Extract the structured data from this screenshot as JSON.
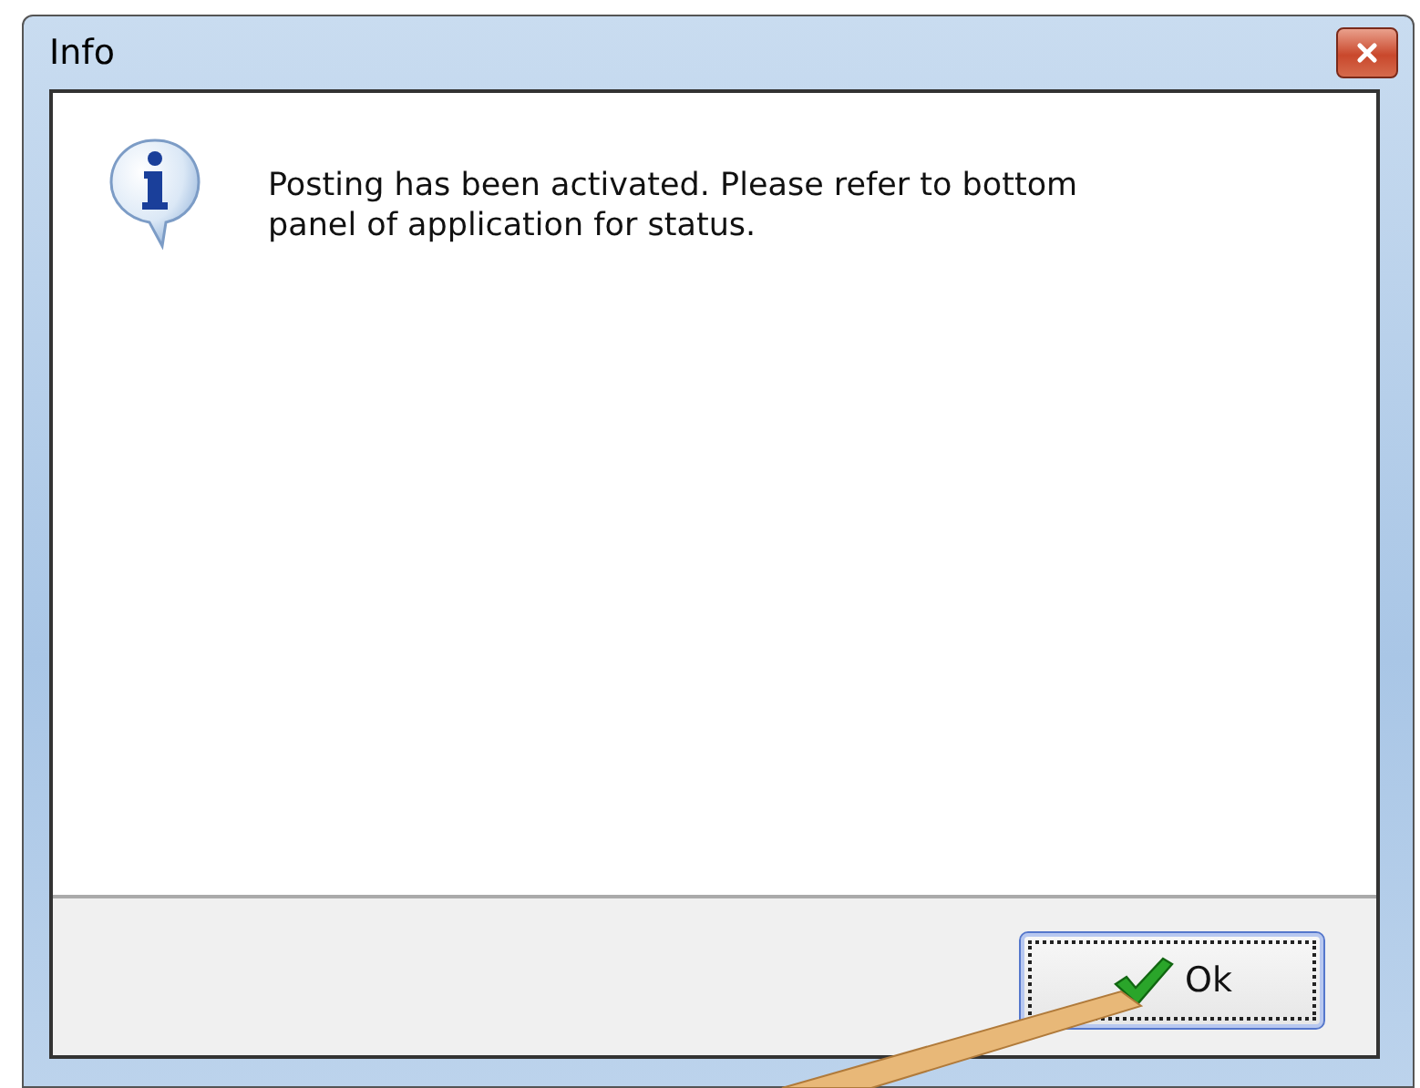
{
  "window": {
    "title": "Info"
  },
  "message": "Posting has been activated. Please refer to bottom panel of application for status.",
  "buttons": [
    {
      "label": "Ok",
      "focused": true
    }
  ]
}
